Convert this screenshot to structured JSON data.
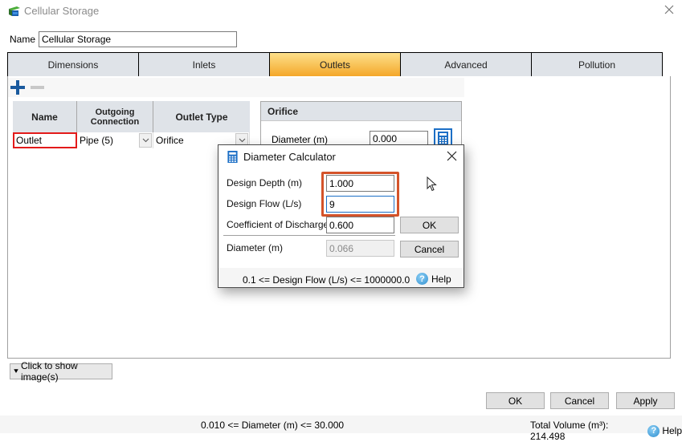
{
  "window": {
    "title": "Cellular Storage",
    "icon": "cellular-storage-icon",
    "close_icon": "close-icon"
  },
  "name_field": {
    "label": "Name",
    "value": "Cellular Storage"
  },
  "tabs": [
    {
      "label": "Dimensions",
      "active": false
    },
    {
      "label": "Inlets",
      "active": false
    },
    {
      "label": "Outlets",
      "active": true
    },
    {
      "label": "Advanced",
      "active": false
    },
    {
      "label": "Pollution",
      "active": false
    }
  ],
  "outlets": {
    "toolbar": {
      "add_icon": "plus-icon",
      "remove_icon": "minus-icon"
    },
    "columns": [
      "Name",
      "Outgoing Connection",
      "Outlet Type"
    ],
    "rows": [
      {
        "name": "Outlet",
        "connection": "Pipe (5)",
        "type": "Orifice"
      }
    ]
  },
  "orifice": {
    "header": "Orifice",
    "diameter_label": "Diameter (m)",
    "diameter_value": "0.000",
    "calculator_icon": "calculator-icon"
  },
  "dialog": {
    "title": "Diameter Calculator",
    "fields": {
      "design_depth": {
        "label": "Design Depth (m)",
        "value": "1.000"
      },
      "design_flow": {
        "label": "Design Flow (L/s)",
        "value": "9"
      },
      "coefficient": {
        "label": "Coefficient of Discharge",
        "value": "0.600"
      },
      "diameter": {
        "label": "Diameter (m)",
        "value": "0.066"
      }
    },
    "ok_label": "OK",
    "cancel_label": "Cancel",
    "range_hint": "0.1 <= Design Flow (L/s) <= 1000000.0",
    "help_label": "Help",
    "highlight_color": "#d4532a"
  },
  "bottom": {
    "show_images_label": "Click to show image(s)",
    "ok_label": "OK",
    "cancel_label": "Cancel",
    "apply_label": "Apply"
  },
  "status": {
    "range_hint": "0.010 <= Diameter (m) <= 30.000",
    "total_volume": "Total Volume (m³): 214.498",
    "help_label": "Help"
  },
  "colors": {
    "active_tab_top": "#fde08a",
    "active_tab_bottom": "#f4a72a",
    "accent_blue": "#1c6fc6",
    "error_red": "#e31a1a"
  }
}
